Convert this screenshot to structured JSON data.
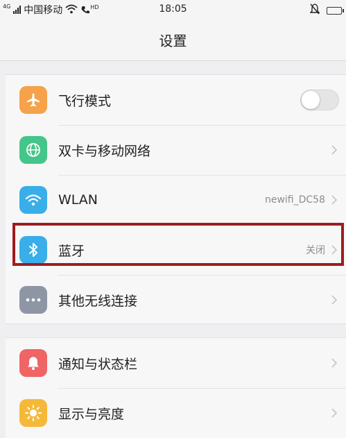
{
  "status_bar": {
    "network": "4G",
    "carrier": "中国移动",
    "call_indicator": "HD",
    "time": "18:05"
  },
  "header": {
    "title": "设置"
  },
  "groups": [
    {
      "items": [
        {
          "label": "飞行模式",
          "icon": "airplane-icon",
          "color": "#f5a24a",
          "control": "toggle",
          "toggle_on": false
        },
        {
          "label": "双卡与移动网络",
          "icon": "globe-icon",
          "color": "#45c58a",
          "control": "chevron"
        },
        {
          "label": "WLAN",
          "icon": "wifi-icon",
          "color": "#3aaee9",
          "value": "newifi_DC58",
          "control": "chevron"
        },
        {
          "label": "蓝牙",
          "icon": "bluetooth-icon",
          "color": "#3aaee9",
          "value": "关闭",
          "control": "chevron"
        },
        {
          "label": "其他无线连接",
          "icon": "more-icon",
          "color": "#8e96a6",
          "control": "chevron"
        }
      ]
    },
    {
      "items": [
        {
          "label": "通知与状态栏",
          "icon": "notification-bell-icon",
          "color": "#ef6464",
          "control": "chevron"
        },
        {
          "label": "显示与亮度",
          "icon": "brightness-icon",
          "color": "#f5b93a",
          "control": "chevron"
        }
      ]
    }
  ],
  "highlight_color": "#9e1b1f"
}
